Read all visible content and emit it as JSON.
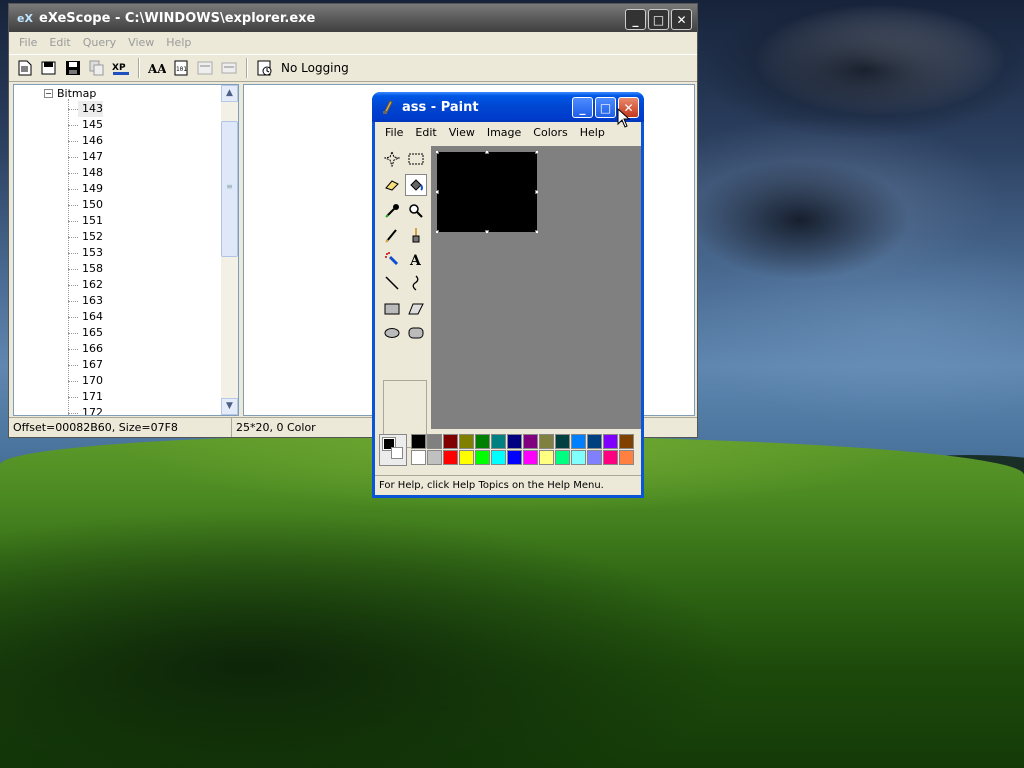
{
  "exescope": {
    "title": "eXeScope - C:\\WINDOWS\\explorer.exe",
    "menu": [
      "File",
      "Edit",
      "Query",
      "View",
      "Help"
    ],
    "toolbar": {
      "logging_label": "No Logging"
    },
    "tree": {
      "root_label": "Bitmap",
      "items": [
        "143",
        "145",
        "146",
        "147",
        "148",
        "149",
        "150",
        "151",
        "152",
        "153",
        "158",
        "162",
        "163",
        "164",
        "165",
        "166",
        "167",
        "170",
        "171",
        "172"
      ],
      "selected": "143"
    },
    "status": {
      "left": "Offset=00082B60, Size=07F8",
      "right": "25*20, 0 Color"
    }
  },
  "paint": {
    "title": "ass - Paint",
    "menu": [
      "File",
      "Edit",
      "View",
      "Image",
      "Colors",
      "Help"
    ],
    "status_text": "For Help, click Help Topics on the Help Menu.",
    "canvas_color": "#000000",
    "foreground_color": "#000000",
    "background_color": "#ffffff",
    "palette_top": [
      "#000000",
      "#808080",
      "#800000",
      "#808000",
      "#008000",
      "#008080",
      "#000080",
      "#800080",
      "#808040",
      "#004040",
      "#0080ff",
      "#004080",
      "#8000ff",
      "#804000"
    ],
    "palette_bottom": [
      "#ffffff",
      "#c0c0c0",
      "#ff0000",
      "#ffff00",
      "#00ff00",
      "#00ffff",
      "#0000ff",
      "#ff00ff",
      "#ffff80",
      "#00ff80",
      "#80ffff",
      "#8080ff",
      "#ff0080",
      "#ff8040"
    ]
  },
  "window_buttons": {
    "minimize": "_",
    "maximize": "□",
    "close": "✕"
  }
}
